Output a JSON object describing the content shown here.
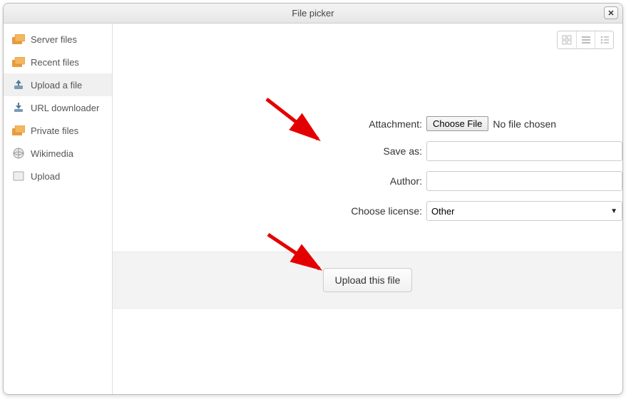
{
  "title": "File picker",
  "sidebar": {
    "items": [
      {
        "label": "Server files",
        "icon": "files-icon"
      },
      {
        "label": "Recent files",
        "icon": "files-icon"
      },
      {
        "label": "Upload a file",
        "icon": "upload-icon"
      },
      {
        "label": "URL downloader",
        "icon": "download-icon"
      },
      {
        "label": "Private files",
        "icon": "files-icon"
      },
      {
        "label": "Wikimedia",
        "icon": "globe-icon"
      },
      {
        "label": "Upload",
        "icon": "box-icon"
      }
    ],
    "active_index": 2
  },
  "form": {
    "attachment_label": "Attachment:",
    "choose_file_label": "Choose File",
    "no_file_text": "No file chosen",
    "save_as_label": "Save as:",
    "save_as_value": "",
    "author_label": "Author:",
    "author_value": "",
    "license_label": "Choose license:",
    "license_value": "Other"
  },
  "submit": {
    "upload_label": "Upload this file"
  }
}
